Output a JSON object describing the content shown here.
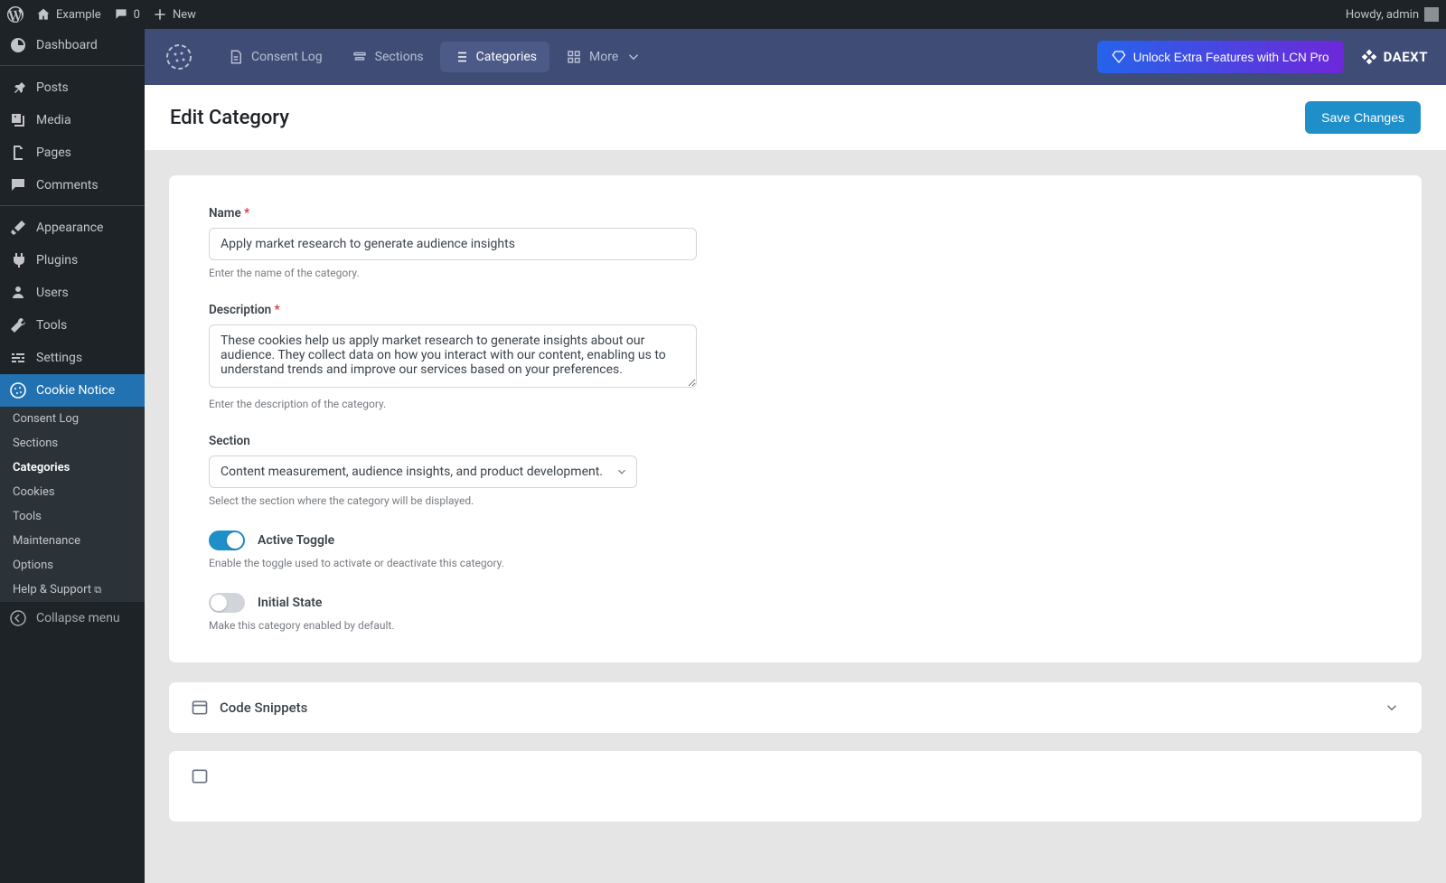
{
  "adminbar": {
    "site": "Example",
    "comments": "0",
    "new": "New",
    "howdy": "Howdy, admin"
  },
  "sidebar": {
    "items": [
      {
        "id": "dashboard",
        "label": "Dashboard"
      },
      {
        "id": "posts",
        "label": "Posts"
      },
      {
        "id": "media",
        "label": "Media"
      },
      {
        "id": "pages",
        "label": "Pages"
      },
      {
        "id": "comments",
        "label": "Comments"
      },
      {
        "id": "appearance",
        "label": "Appearance"
      },
      {
        "id": "plugins",
        "label": "Plugins"
      },
      {
        "id": "users",
        "label": "Users"
      },
      {
        "id": "tools",
        "label": "Tools"
      },
      {
        "id": "settings",
        "label": "Settings"
      },
      {
        "id": "cookie",
        "label": "Cookie Notice"
      }
    ],
    "submenu": [
      "Consent Log",
      "Sections",
      "Categories",
      "Cookies",
      "Tools",
      "Maintenance",
      "Options",
      "Help & Support"
    ],
    "collapse": "Collapse menu"
  },
  "plugin_nav": {
    "consent_log": "Consent Log",
    "sections": "Sections",
    "categories": "Categories",
    "more": "More",
    "unlock": "Unlock Extra Features with LCN Pro",
    "brand": "DAEXT"
  },
  "page": {
    "title": "Edit Category",
    "save": "Save Changes"
  },
  "form": {
    "name_label": "Name",
    "name_value": "Apply market research to generate audience insights",
    "name_hint": "Enter the name of the category.",
    "desc_label": "Description",
    "desc_value": "These cookies help us apply market research to generate insights about our audience. They collect data on how you interact with our content, enabling us to understand trends and improve our services based on your preferences.",
    "desc_hint": "Enter the description of the category.",
    "section_label": "Section",
    "section_value": "Content measurement, audience insights, and product development.",
    "section_hint": "Select the section where the category will be displayed.",
    "active_label": "Active Toggle",
    "active_hint": "Enable the toggle used to activate or deactivate this category.",
    "initial_label": "Initial State",
    "initial_hint": "Make this category enabled by default."
  },
  "panels": {
    "code_snippets": "Code Snippets"
  }
}
